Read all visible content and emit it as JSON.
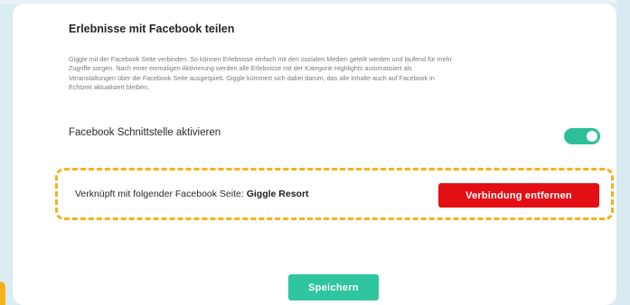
{
  "colors": {
    "page_background": "#dcecf3",
    "card_background": "#ffffff",
    "toggle_on": "#2dbf9a",
    "highlight_border": "#f6b21c",
    "danger": "#e40f14",
    "primary": "#2fc59f"
  },
  "section": {
    "title": "Erlebnisse mit Facebook teilen",
    "description": "Giggle mit der Facebook Seite verbinden. So können Erlebnisse einfach mit den sozialen Medien geteilt werden und laufend für mehr Zugriffe sorgen. Nach einer einmaligen Aktivierung werden alle Erlebnisse mit der Kategorie Highlights automatisiert als Veranstaltungen über die Facebook Seite ausgespielt. Giggle kümmert sich dabei darum, das alle Inhalte auch auf Facebook in Echtzeit aktualisiert bleiben."
  },
  "interface_toggle": {
    "label": "Facebook Schnittstelle aktivieren",
    "state": "on"
  },
  "linked_page": {
    "prefix": "Verknüpft mit folgender Facebook Seite:",
    "page_name": "Giggle Resort",
    "remove_button": "Verbindung entfernen"
  },
  "footer": {
    "save_button": "Speichern"
  }
}
